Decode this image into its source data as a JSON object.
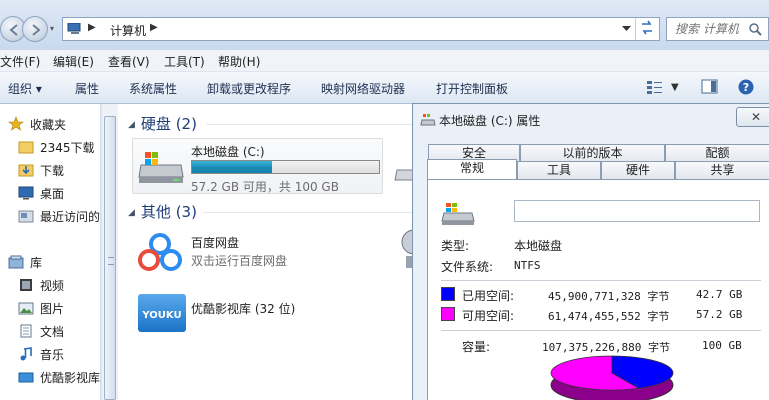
{
  "address": {
    "crumb": "计算机",
    "search_placeholder": "搜索 计算机"
  },
  "menu": [
    "文件(F)",
    "编辑(E)",
    "查看(V)",
    "工具(T)",
    "帮助(H)"
  ],
  "toolbar": {
    "organize": "组织 ▾",
    "properties": "属性",
    "system_properties": "系统属性",
    "uninstall": "卸载或更改程序",
    "map_drive": "映射网络驱动器",
    "control_panel": "打开控制面板"
  },
  "sidebar": {
    "favorites": "收藏夹",
    "downloads_2345": "2345下载",
    "downloads": "下载",
    "desktop": "桌面",
    "recent": "最近访问的",
    "libraries": "库",
    "videos": "视频",
    "pictures": "图片",
    "documents": "文档",
    "music": "音乐",
    "youku_lib": "优酷影视库"
  },
  "content": {
    "hard_disks_header": "硬盘 (2)",
    "drive_c_name": "本地磁盘 (C:)",
    "drive_c_used_fraction": 0.4275,
    "drive_c_free": "57.2 GB 可用，共 100 GB",
    "other_header": "其他 (3)",
    "baidu_title": "百度网盘",
    "baidu_sub": "双击运行百度网盘",
    "youku_title": "优酷影视库 (32 位)",
    "youku_logo": "YOUKU"
  },
  "dialog": {
    "title": "本地磁盘 (C:) 属性",
    "close_label": "✕",
    "tabs_back": [
      "安全",
      "以前的版本",
      "配额"
    ],
    "tabs_front": [
      "常规",
      "工具",
      "硬件",
      "共享"
    ],
    "type_label": "类型:",
    "type_value": "本地磁盘",
    "fs_label": "文件系统:",
    "fs_value": "NTFS",
    "used_label": "已用空间:",
    "used_bytes": "45,900,771,328 字节",
    "used_gb": "42.7 GB",
    "free_label": "可用空间:",
    "free_bytes": "61,474,455,552 字节",
    "free_gb": "57.2 GB",
    "capacity_label": "容量:",
    "capacity_bytes": "107,375,226,880 字节",
    "capacity_gb": "100 GB",
    "used_color": "#0000ff",
    "free_color": "#ff00ff"
  }
}
